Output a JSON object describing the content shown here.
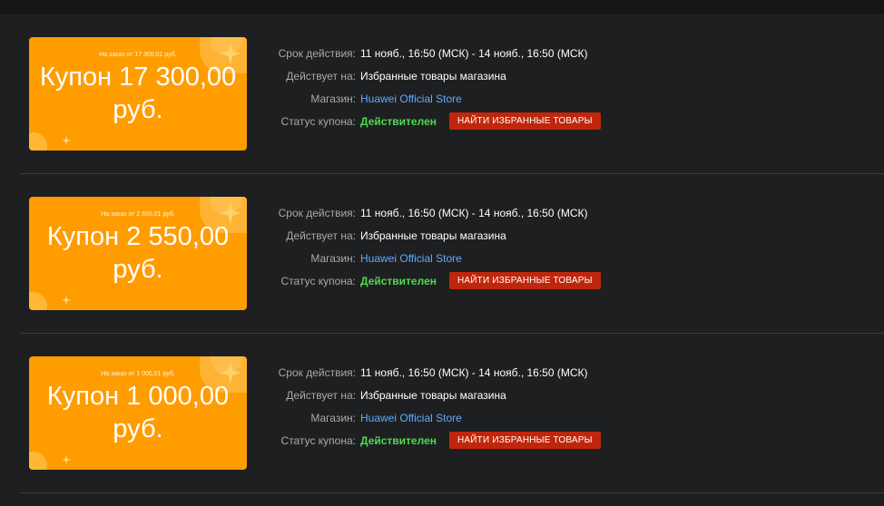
{
  "coupons": [
    {
      "min_order": "На заказ от 17 300,01 руб.",
      "amount_line1": "Купон 17 300,00",
      "amount_line2": "руб.",
      "validity_label": "Срок действия:",
      "validity": "11 нояб., 16:50 (МСК) - 14 нояб., 16:50 (МСК)",
      "applies_label": "Действует на:",
      "applies": "Избранные товары магазина",
      "store_label": "Магазин:",
      "store": "Huawei Official Store",
      "status_label": "Статус купона:",
      "status": "Действителен",
      "button": "НАЙТИ ИЗБРАННЫЕ ТОВАРЫ"
    },
    {
      "min_order": "На заказ от 2 550,01 руб.",
      "amount_line1": "Купон 2 550,00",
      "amount_line2": "руб.",
      "validity_label": "Срок действия:",
      "validity": "11 нояб., 16:50 (МСК) - 14 нояб., 16:50 (МСК)",
      "applies_label": "Действует на:",
      "applies": "Избранные товары магазина",
      "store_label": "Магазин:",
      "store": "Huawei Official Store",
      "status_label": "Статус купона:",
      "status": "Действителен",
      "button": "НАЙТИ ИЗБРАННЫЕ ТОВАРЫ"
    },
    {
      "min_order": "На заказ от 1 000,01 руб.",
      "amount_line1": "Купон 1 000,00",
      "amount_line2": "руб.",
      "validity_label": "Срок действия:",
      "validity": "11 нояб., 16:50 (МСК) - 14 нояб., 16:50 (МСК)",
      "applies_label": "Действует на:",
      "applies": "Избранные товары магазина",
      "store_label": "Магазин:",
      "store": "Huawei Official Store",
      "status_label": "Статус купона:",
      "status": "Действителен",
      "button": "НАЙТИ ИЗБРАННЫЕ ТОВАРЫ"
    }
  ],
  "colors": {
    "coupon_bg": "#ff9c00",
    "button_bg": "#c0260b",
    "status": "#4fdb4f",
    "link": "#5eaaff",
    "page_bg": "#1e1f21"
  },
  "icons": {
    "decor": "sparkle-icon"
  }
}
